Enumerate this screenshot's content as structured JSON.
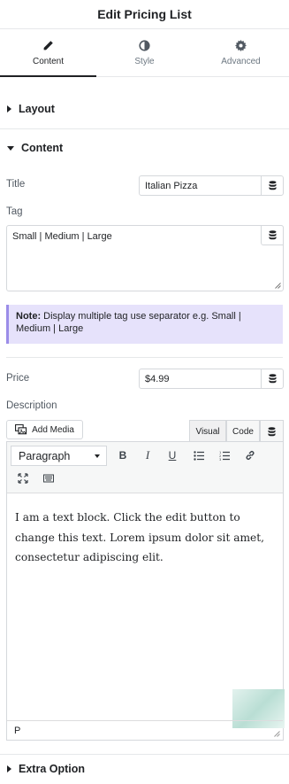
{
  "header": {
    "title": "Edit Pricing List"
  },
  "tabs": [
    {
      "label": "Content",
      "icon": "pencil-icon",
      "active": true
    },
    {
      "label": "Style",
      "icon": "contrast-icon",
      "active": false
    },
    {
      "label": "Advanced",
      "icon": "gear-icon",
      "active": false
    }
  ],
  "sections": {
    "layout": "Layout",
    "content": "Content",
    "extra": "Extra Option"
  },
  "fields": {
    "title_label": "Title",
    "title_value": "Italian Pizza",
    "tag_label": "Tag",
    "tag_value": "Small | Medium | Large",
    "note_bold": "Note:",
    "note_text": " Display multiple tag use separator e.g. Small | Medium | Large",
    "price_label": "Price",
    "price_value": "$4.99",
    "description_label": "Description"
  },
  "editor": {
    "add_media": "Add Media",
    "visual_tab": "Visual",
    "code_tab": "Code",
    "format": "Paragraph",
    "bold": "B",
    "italic": "I",
    "underline": "U",
    "body": "I am a text block. Click the edit button to change this text. Lorem ipsum dolor sit amet, consectetur adipiscing elit.",
    "status_path": "P"
  },
  "colors": {
    "note_background": "#e6e2fb",
    "note_border": "#9b8de8",
    "accent": "#1f2124"
  }
}
